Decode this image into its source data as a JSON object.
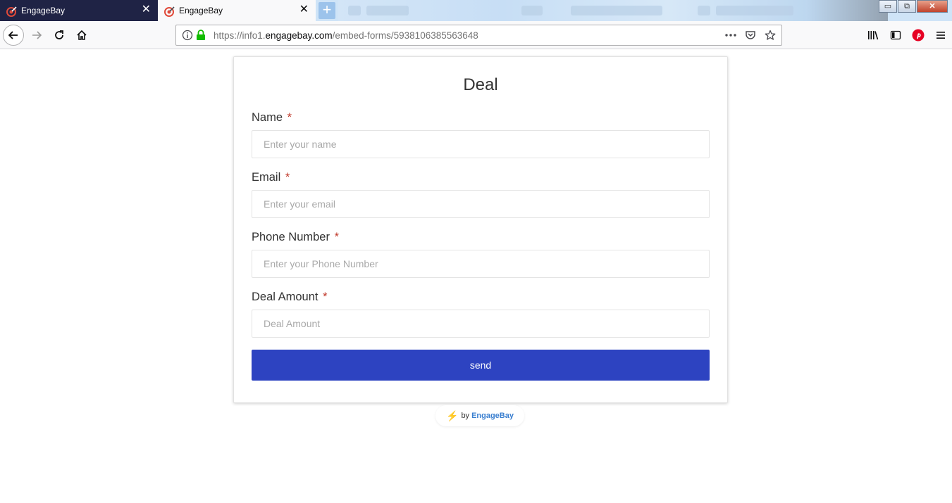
{
  "browser": {
    "tabs": [
      {
        "label": "EngageBay",
        "active": false
      },
      {
        "label": "EngageBay",
        "active": true
      }
    ],
    "new_tab_symbol": "+",
    "url": {
      "scheme": "https://info1.",
      "host": "engagebay.com",
      "path": "/embed-forms/5938106385563648"
    },
    "icons": {
      "back": "back-arrow-icon",
      "forward": "forward-arrow-icon",
      "reload": "reload-icon",
      "home": "home-icon",
      "info": "info-icon",
      "lock": "lock-icon",
      "page_actions": "more-dots-icon",
      "pocket": "pocket-icon",
      "bookmark": "star-icon",
      "library": "library-icon",
      "sidebar": "sidebar-icon",
      "pinterest": "pinterest-icon",
      "menu": "hamburger-menu-icon"
    },
    "window_controls": {
      "minimize": "▭",
      "restore": "⧉",
      "close": "✕"
    }
  },
  "form": {
    "title": "Deal",
    "required_marker": "*",
    "fields": [
      {
        "label": "Name",
        "placeholder": "Enter your name"
      },
      {
        "label": "Email",
        "placeholder": "Enter your email"
      },
      {
        "label": "Phone Number",
        "placeholder": "Enter your Phone Number"
      },
      {
        "label": "Deal Amount",
        "placeholder": "Deal Amount"
      }
    ],
    "submit_label": "send"
  },
  "powered_by": {
    "prefix": "by",
    "brand": "EngageBay"
  },
  "colors": {
    "button": "#2d43c1",
    "required": "#c0392b",
    "brand_link": "#3a7fd0",
    "bolt": "#f3a81d"
  }
}
